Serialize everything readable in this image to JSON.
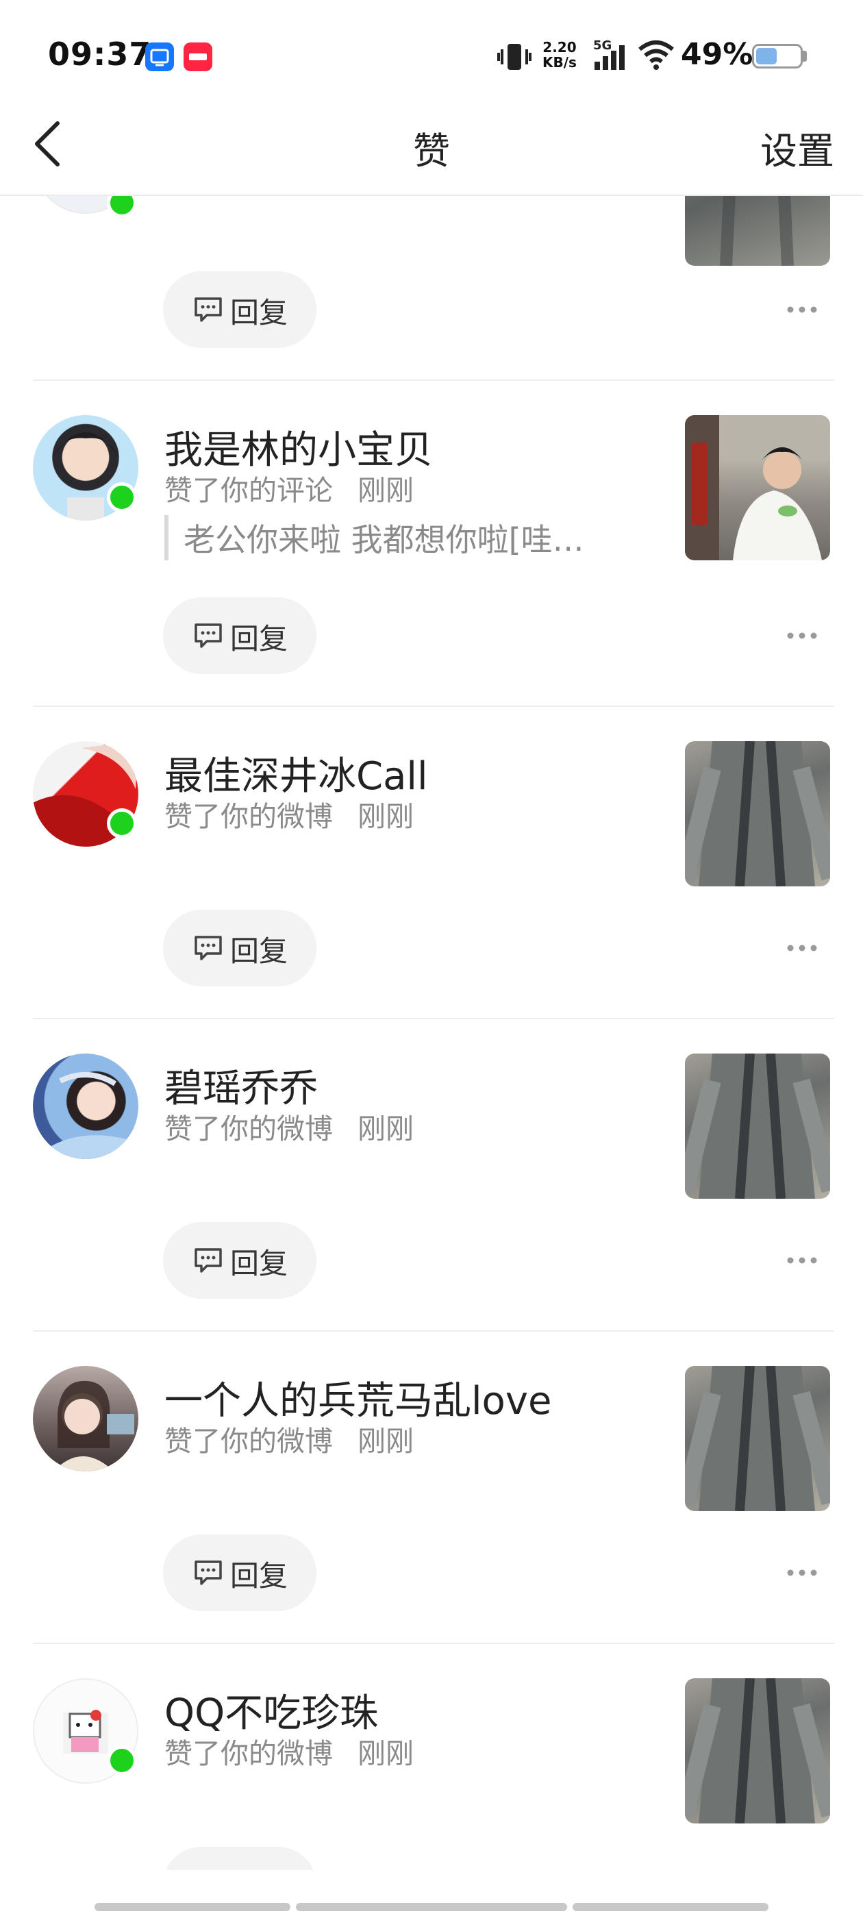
{
  "status_bar": {
    "time": "09:37",
    "net_speed_value": "2.20",
    "net_speed_unit": "KB/s",
    "network": "5G",
    "battery_percent": "49%",
    "battery_level": 0.49
  },
  "nav": {
    "title": "赞",
    "settings_label": "设置"
  },
  "reply_label": "回复",
  "notifications": [
    {
      "username": "我是林的小宝贝",
      "action": "赞了你的评论",
      "time": "刚刚",
      "quote": "老公你来啦  我都想你啦[哇…",
      "online": true
    },
    {
      "username": "最佳深井冰Call",
      "action": "赞了你的微博",
      "time": "刚刚",
      "online": true
    },
    {
      "username": "碧瑶乔乔",
      "action": "赞了你的微博",
      "time": "刚刚",
      "online": false
    },
    {
      "username": "一个人的兵荒马乱love",
      "action": "赞了你的微博",
      "time": "刚刚",
      "online": false
    },
    {
      "username": "QQ不吃珍珠",
      "action": "赞了你的微博",
      "time": "刚刚",
      "online": true
    }
  ],
  "colors": {
    "online": "#1dd21d",
    "reply_bg": "#f3f3f3",
    "meta_text": "#8a8a8a"
  }
}
